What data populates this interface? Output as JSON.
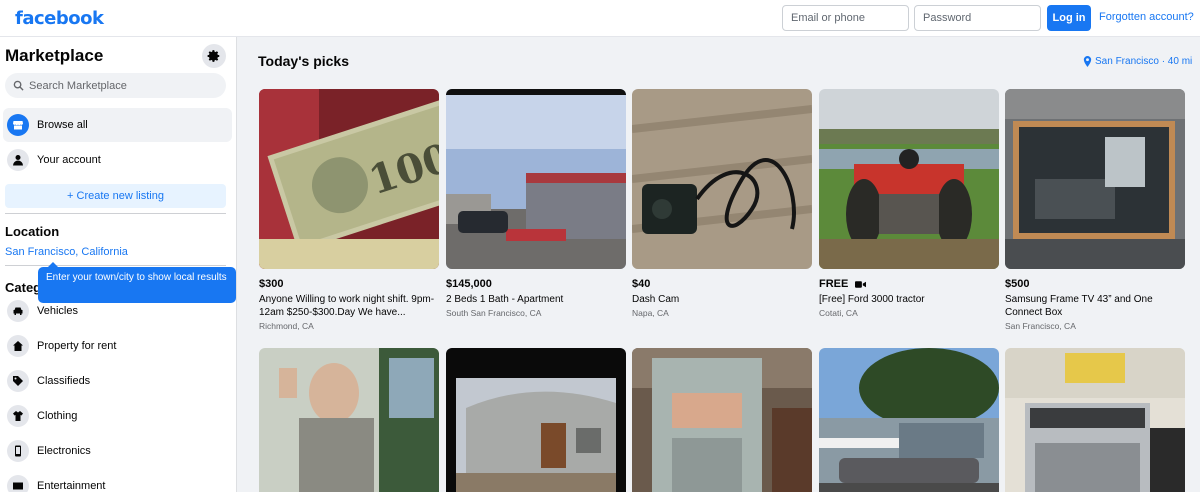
{
  "topbar": {
    "logo": "facebook",
    "email_placeholder": "Email or phone",
    "password_placeholder": "Password",
    "login_label": "Log in",
    "forgot_label": "Forgotten account?"
  },
  "sidebar": {
    "title": "Marketplace",
    "search_placeholder": "Search Marketplace",
    "nav": [
      {
        "label": "Browse all",
        "icon": "storefront-icon"
      },
      {
        "label": "Your account",
        "icon": "person-icon"
      }
    ],
    "create_label": "+ Create new listing",
    "location_title": "Location",
    "location_value": "San Francisco, California",
    "tooltip": "Enter your town/city to show local results",
    "categories_title": "Categories",
    "categories": [
      {
        "label": "Vehicles",
        "icon": "car-icon"
      },
      {
        "label": "Property for rent",
        "icon": "house-icon"
      },
      {
        "label": "Classifieds",
        "icon": "tag-icon"
      },
      {
        "label": "Clothing",
        "icon": "shirt-icon"
      },
      {
        "label": "Electronics",
        "icon": "phone-icon"
      },
      {
        "label": "Entertainment",
        "icon": "film-icon"
      }
    ]
  },
  "main": {
    "title": "Today's picks",
    "location_badge": "San Francisco · 40 mi",
    "listings": [
      {
        "price": "$300",
        "title": "Anyone Willing to work night shift. 9pm-12am $250-$300.Day We have...",
        "location": "Richmond, CA",
        "image": "money-photo"
      },
      {
        "price": "$145,000",
        "title": "2 Beds 1 Bath - Apartment",
        "location": "South San Francisco, CA",
        "image": "mobile-home-photo"
      },
      {
        "price": "$40",
        "title": "Dash Cam",
        "location": "Napa, CA",
        "image": "dash-cam-photo"
      },
      {
        "price": "FREE",
        "title": "[Free] Ford 3000 tractor",
        "location": "Cotati, CA",
        "image": "tractor-photo",
        "video": true
      },
      {
        "price": "$500",
        "title": "Samsung Frame TV 43” and One Connect Box",
        "location": "San Francisco, CA",
        "image": "tv-photo"
      },
      {
        "image": "doll-photo"
      },
      {
        "image": "trailer-photo"
      },
      {
        "image": "cabinet-photo"
      },
      {
        "image": "house-car-photo"
      },
      {
        "image": "stove-photo"
      }
    ]
  },
  "colors": {
    "brand": "#1877f2",
    "background": "#f0f2f5"
  }
}
